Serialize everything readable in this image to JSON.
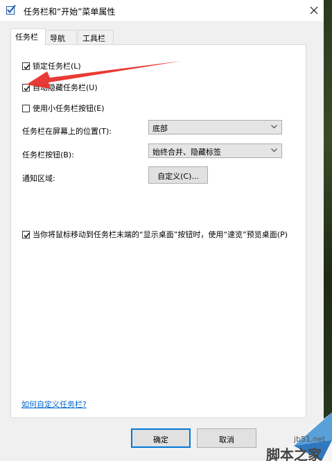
{
  "window": {
    "title": "任务栏和“开始”菜单属性"
  },
  "tabs": [
    {
      "label": "任务栏",
      "active": true
    },
    {
      "label": "导航",
      "active": false
    },
    {
      "label": "工具栏",
      "active": false
    }
  ],
  "options": {
    "lock_taskbar": {
      "label": "锁定任务栏(L)",
      "checked": true
    },
    "auto_hide": {
      "label": "自动隐藏任务栏(U)",
      "checked": true
    },
    "small_buttons": {
      "label": "使用小任务栏按钮(E)",
      "checked": false
    }
  },
  "position": {
    "label": "任务栏在屏幕上的位置(T):",
    "value": "底部"
  },
  "buttons_combine": {
    "label": "任务栏按钮(B):",
    "value": "始终合并、隐藏标签"
  },
  "notification": {
    "label": "通知区域:",
    "button_label": "自定义(C)..."
  },
  "peek": {
    "label": "当你将鼠标移动到任务栏末端的“显示桌面”按钮时，使用“速览”预览桌面(P)",
    "checked": true
  },
  "help_link": "如何自定义任务栏?",
  "footer": {
    "ok_label": "确定",
    "cancel_label": "取消"
  },
  "watermark": {
    "site": "jb51.net",
    "brand": "脚本之家"
  },
  "colors": {
    "annotation_arrow": "#e8302a",
    "link": "#0066cc",
    "primary_border": "#0078d7"
  }
}
